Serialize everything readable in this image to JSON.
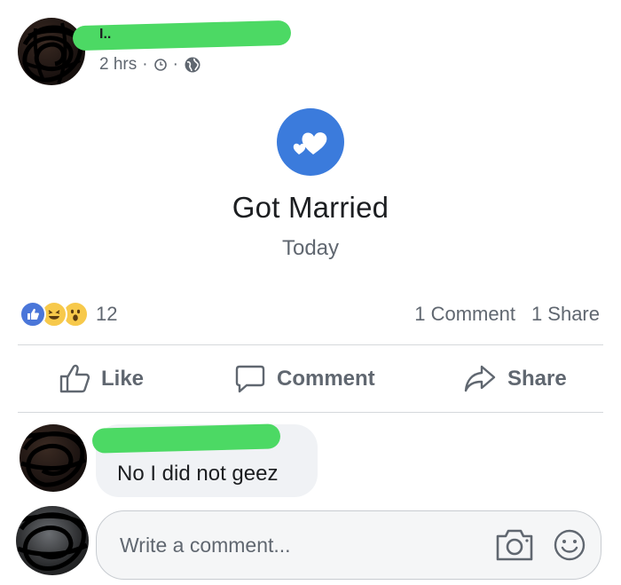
{
  "post": {
    "timestamp": "2 hrs",
    "separator": "·"
  },
  "life_event": {
    "title": "Got Married",
    "date": "Today",
    "icon": "hearts-icon",
    "accent": "#3b7bdc"
  },
  "reactions": {
    "types": [
      "like",
      "haha",
      "wow"
    ],
    "count": "12"
  },
  "stats": {
    "comments": "1 Comment",
    "shares": "1 Share"
  },
  "actions": {
    "like": "Like",
    "comment": "Comment",
    "share": "Share"
  },
  "comment": {
    "text": "No I did not geez"
  },
  "compose": {
    "placeholder": "Write a comment..."
  }
}
